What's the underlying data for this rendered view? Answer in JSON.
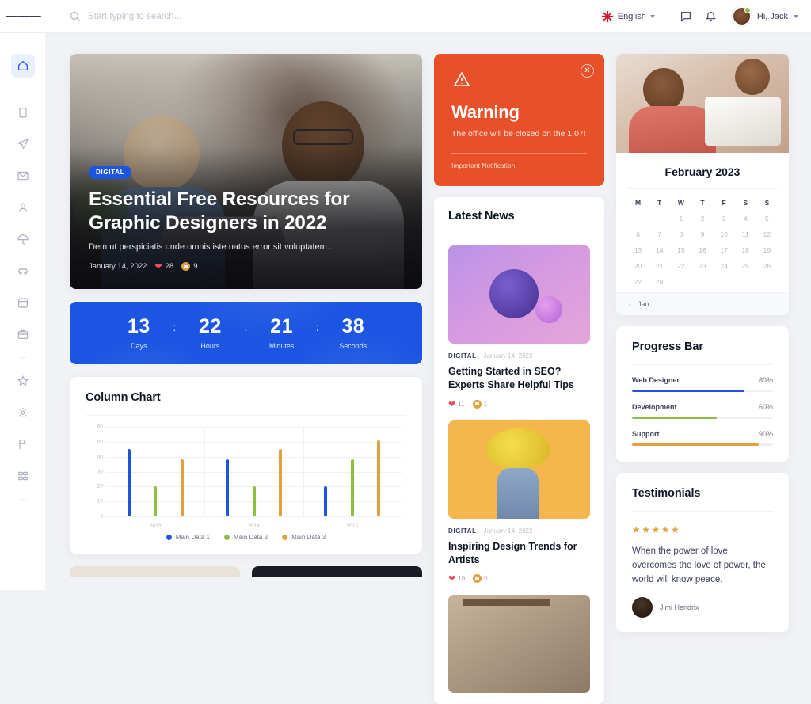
{
  "topbar": {
    "menu_icon": "hamburger-icon",
    "search": {
      "placeholder": "Start typing to search...",
      "value": "",
      "icon": "search-icon"
    },
    "language": {
      "label": "English",
      "icon": "uk-flag-icon"
    },
    "messages_icon": "chat-bubble-icon",
    "notifications_icon": "bell-icon",
    "profile": {
      "greeting": "Hi, Jack",
      "avatar": "user-avatar"
    }
  },
  "sidebar": {
    "items": [
      {
        "name": "dashboard",
        "icon": "home-icon",
        "active": true
      },
      {
        "name": "apps",
        "icon": "clipboard-icon",
        "active": false
      },
      {
        "name": "send",
        "icon": "paper-plane-icon",
        "active": false
      },
      {
        "name": "mailbox",
        "icon": "mail-icon",
        "active": false
      },
      {
        "name": "contacts",
        "icon": "user-icon",
        "active": false
      },
      {
        "name": "notes",
        "icon": "umbrella-icon",
        "active": false
      },
      {
        "name": "scrumboard",
        "icon": "car-icon",
        "active": false
      },
      {
        "name": "calendar",
        "icon": "calendar-icon",
        "active": false
      },
      {
        "name": "invoice",
        "icon": "briefcase-icon",
        "active": false
      },
      {
        "name": "favorites",
        "icon": "star-icon",
        "active": false
      },
      {
        "name": "settings",
        "icon": "gear-icon",
        "active": false
      },
      {
        "name": "pages",
        "icon": "flag-icon",
        "active": false
      },
      {
        "name": "widgets",
        "icon": "layout-icon",
        "active": false
      }
    ]
  },
  "hero": {
    "badge": "DIGITAL",
    "title_line1": "Essential Free Resources for",
    "title_line2": "Graphic Designers in 2022",
    "excerpt": "Dem ut perspiciatis unde omnis iste natus error sit voluptatem...",
    "date": "January 14, 2022",
    "likes": "28",
    "comments": "9"
  },
  "countdown": {
    "units": [
      {
        "value": "13",
        "label": "Days"
      },
      {
        "value": "22",
        "label": "Hours"
      },
      {
        "value": "21",
        "label": "Minutes"
      },
      {
        "value": "38",
        "label": "Seconds"
      }
    ],
    "separator": ":"
  },
  "chart_data": {
    "type": "bar",
    "title": "Column Chart",
    "categories": [
      "2013",
      "2014",
      "2015"
    ],
    "series": [
      {
        "name": "Main Data 1",
        "color": "#1b55e2",
        "values": [
          45,
          38,
          20
        ]
      },
      {
        "name": "Main Data 2",
        "color": "#8dbf42",
        "values": [
          20,
          20,
          38
        ]
      },
      {
        "name": "Main Data 3",
        "color": "#e2a03f",
        "values": [
          38,
          45,
          51
        ]
      }
    ],
    "xlabel": "",
    "ylabel": "",
    "ylim": [
      0,
      60
    ],
    "yticks": [
      0,
      10,
      20,
      30,
      40,
      50,
      60
    ],
    "grid": true,
    "legend_position": "bottom"
  },
  "warning": {
    "icon": "alert-triangle-icon",
    "close_icon": "close-icon",
    "title": "Warning",
    "message": "The office will be closed on the 1.07!",
    "footer": "Important Notification"
  },
  "news": {
    "title": "Latest News",
    "items": [
      {
        "thumb": "abstract-spheres-image",
        "category": "DIGITAL",
        "date": "January 14, 2022",
        "title": "Getting Started in SEO? Experts Share Helpful Tips",
        "likes": "11",
        "comments": "1"
      },
      {
        "thumb": "tulips-portrait-image",
        "category": "DIGITAL",
        "date": "January 14, 2022",
        "title": "Inspiring Design Trends for Artists",
        "likes": "10",
        "comments": "0"
      },
      {
        "thumb": "kitchen-portrait-image",
        "category": "",
        "date": "",
        "title": "",
        "likes": "",
        "comments": ""
      }
    ]
  },
  "calendar": {
    "header_image": "woman-reading-image",
    "title": "February 2023",
    "dow": [
      "M",
      "T",
      "W",
      "T",
      "F",
      "S",
      "S"
    ],
    "lead_blanks": 2,
    "days": [
      1,
      2,
      3,
      4,
      5,
      6,
      7,
      8,
      9,
      10,
      11,
      12,
      13,
      14,
      15,
      16,
      17,
      18,
      19,
      20,
      21,
      22,
      23,
      24,
      25,
      26,
      27,
      28
    ],
    "prev_icon": "chevron-left-icon",
    "prev_label": "Jan"
  },
  "progress": {
    "title": "Progress Bar",
    "rows": [
      {
        "label": "Web Designer",
        "value": "80%",
        "percent": 80,
        "color": "#1b55e2"
      },
      {
        "label": "Development",
        "value": "60%",
        "percent": 60,
        "color": "#8dbf42"
      },
      {
        "label": "Support",
        "value": "90%",
        "percent": 90,
        "color": "#e2a03f"
      }
    ]
  },
  "testimonials": {
    "title": "Testimonials",
    "stars": "★★★★★",
    "quote": "When the power of love overcomes the love of power, the world will know peace.",
    "author": "Jimi Hendrix"
  },
  "colors": {
    "primary": "#1b55e2",
    "warning_bg": "#e8502a",
    "success": "#8dbf42",
    "accent": "#e2a03f",
    "danger": "#e7515a",
    "page_bg": "#f1f2f6"
  }
}
